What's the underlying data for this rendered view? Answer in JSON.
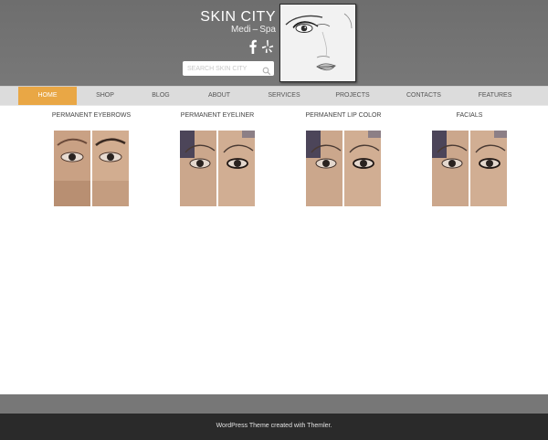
{
  "header": {
    "site_title": "SKIN CITY",
    "tagline": "Medi – Spa",
    "search": {
      "placeholder": "SEARCH SKIN CITY",
      "icon": "search-icon"
    },
    "social": [
      {
        "name": "facebook-icon"
      },
      {
        "name": "yelp-icon"
      }
    ],
    "logo": {
      "icon": "face-sketch-logo"
    }
  },
  "nav": {
    "items": [
      {
        "label": "HOME",
        "active": true
      },
      {
        "label": "SHOP"
      },
      {
        "label": "BLOG"
      },
      {
        "label": "ABOUT"
      },
      {
        "label": "SERVICES"
      },
      {
        "label": "PROJECTS"
      },
      {
        "label": "CONTACTS"
      },
      {
        "label": "FEATURES"
      }
    ],
    "active_color": "#e9a745"
  },
  "services": [
    {
      "title": "PERMANENT EYEBROWS",
      "image": "before-after-eye-photo"
    },
    {
      "title": "PERMANENT EYELINER",
      "image": "before-after-eye-photo"
    },
    {
      "title": "PERMANENT LIP COLOR",
      "image": "before-after-eye-photo"
    },
    {
      "title": "FACIALS",
      "image": "before-after-eye-photo"
    }
  ],
  "footer": {
    "text": "WordPress Theme created with Themler."
  },
  "colors": {
    "header": "#707070",
    "nav": "#dcdcdc",
    "footer": "#2a2a2a",
    "footer_band": "#777777"
  }
}
